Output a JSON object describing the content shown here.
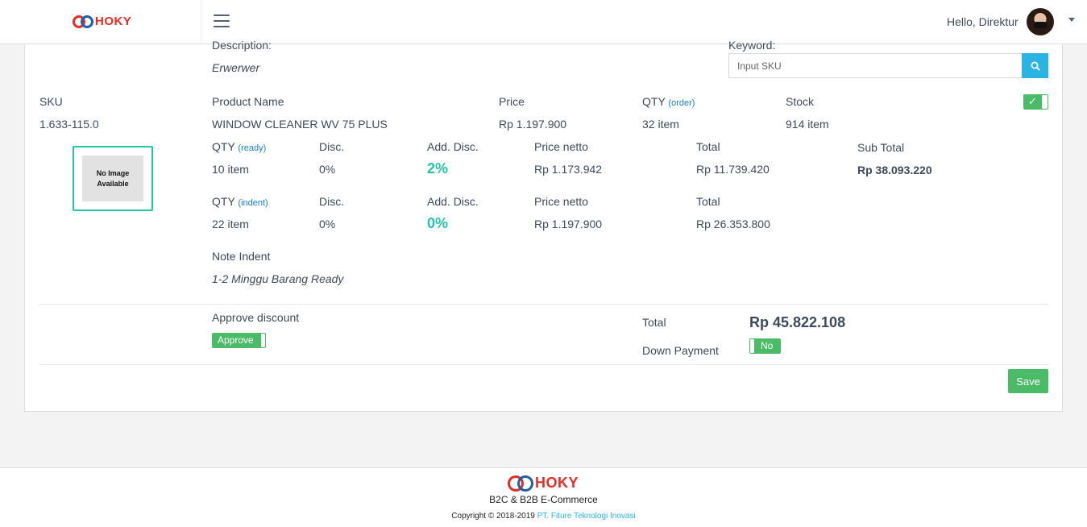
{
  "app": {
    "brand": "HOKY"
  },
  "header": {
    "greeting": "Hello, Direktur"
  },
  "top": {
    "description_label": "Description:",
    "description_value": "Erwerwer",
    "keyword_label": "Keyword:",
    "search_placeholder": "Input SKU"
  },
  "product": {
    "sku_label": "SKU",
    "sku_value": "1.633-115.0",
    "name_label": "Product Name",
    "name_value": "WINDOW CLEANER WV 75 PLUS",
    "price_label": "Price",
    "price_value": "Rp 1.197.900",
    "qty_label": "QTY",
    "qty_tag": "(order)",
    "qty_value": "32 item",
    "stock_label": "Stock",
    "stock_value": "914 item",
    "toggle_mark": "✓",
    "no_image_text": "No Image Available"
  },
  "ready": {
    "qty_label": "QTY",
    "qty_tag": "(ready)",
    "qty_value": "10 item",
    "disc_label": "Disc.",
    "disc_value": "0%",
    "add_disc_label": "Add. Disc.",
    "add_disc_value": "2%",
    "netto_label": "Price netto",
    "netto_value": "Rp 1.173.942",
    "total_label": "Total",
    "total_value": "Rp 11.739.420"
  },
  "indent": {
    "qty_label": "QTY",
    "qty_tag": "(indent)",
    "qty_value": "22 item",
    "disc_label": "Disc.",
    "disc_value": "0%",
    "add_disc_label": "Add. Disc.",
    "add_disc_value": "0%",
    "netto_label": "Price netto",
    "netto_value": "Rp 1.197.900",
    "total_label": "Total",
    "total_value": "Rp 26.353.800"
  },
  "subtotal": {
    "label": "Sub Total",
    "value": "Rp 38.093.220"
  },
  "note": {
    "label": "Note Indent",
    "value": "1-2 Minggu Barang Ready"
  },
  "summary": {
    "approve_label": "Approve discount",
    "approve_button": "Approve",
    "total_label": "Total",
    "total_value": "Rp 45.822.108",
    "dp_label": "Down Payment",
    "dp_toggle": "No",
    "save_button": "Save"
  },
  "footer": {
    "tagline": "B2C & B2B E-Commerce",
    "copyright": "Copyright © 2018-2019",
    "company": "PT. Fiture Teknologi Inovasi"
  },
  "colors": {
    "accent_green": "#4cbb68",
    "accent_teal": "#22c5a4",
    "search_blue": "#2bb3e2",
    "brand_red": "#e52d27"
  },
  "icons": {
    "search": "search-icon",
    "menu": "hamburger-icon",
    "dropdown": "chevron-down-icon"
  }
}
